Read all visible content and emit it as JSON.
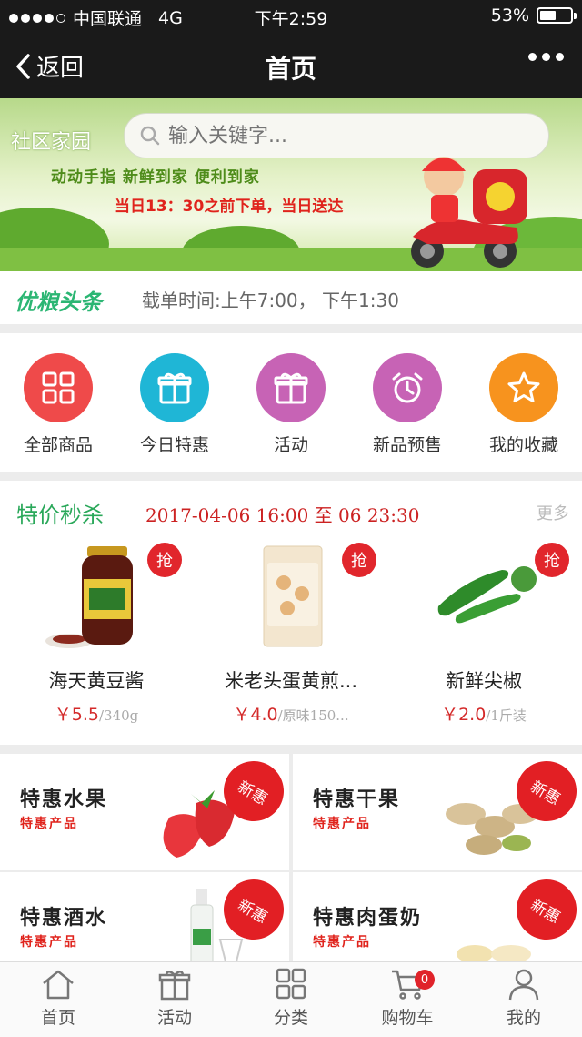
{
  "status": {
    "carrier": "中国联通",
    "network": "4G",
    "time": "下午2:59",
    "battery": "53%",
    "battery_level": 0.53
  },
  "nav": {
    "back_label": "返回",
    "title": "首页"
  },
  "banner": {
    "brand": "社区家园",
    "search_placeholder": "输入关键字...",
    "slogan": "动动手指  新鲜到家  便利到家",
    "slogan2": "当日13：30之前下单，当日送达"
  },
  "notice": {
    "tag": "优粮头条",
    "text": "截单时间:上午7:00，  下午1:30"
  },
  "categories": [
    {
      "label": "全部商品",
      "icon": "grid-icon",
      "color": "#ef4a4a"
    },
    {
      "label": "今日特惠",
      "icon": "gift-icon",
      "color": "#1fb6d6"
    },
    {
      "label": "活动",
      "icon": "gift-icon",
      "color": "#c763b5"
    },
    {
      "label": "新品预售",
      "icon": "alarm-clock-icon",
      "color": "#c763b5"
    },
    {
      "label": "我的收藏",
      "icon": "star-icon",
      "color": "#f7931e"
    }
  ],
  "flash_sale": {
    "title": "特价秒杀",
    "time": "2017-04-06 16:00 至 06 23:30",
    "more": "更多",
    "grab_label": "抢",
    "products": [
      {
        "name": "海天黄豆酱",
        "price": "￥5.5",
        "unit": "/340g"
      },
      {
        "name": "米老头蛋黄煎...",
        "price": "￥4.0",
        "unit": "/原味150..."
      },
      {
        "name": "新鲜尖椒",
        "price": "￥2.0",
        "unit": "/1斤装"
      }
    ]
  },
  "specials": [
    {
      "title": "特惠水果",
      "sub": "特惠产品",
      "tag": "新惠"
    },
    {
      "title": "特惠干果",
      "sub": "特惠产品",
      "tag": "新惠"
    },
    {
      "title": "特惠酒水",
      "sub": "特惠产品",
      "tag": "新惠"
    },
    {
      "title": "特惠肉蛋奶",
      "sub": "特惠产品",
      "tag": "新惠"
    }
  ],
  "tabbar": [
    {
      "label": "首页",
      "icon": "home-icon"
    },
    {
      "label": "活动",
      "icon": "gift-icon"
    },
    {
      "label": "分类",
      "icon": "grid-icon"
    },
    {
      "label": "购物车",
      "icon": "cart-icon",
      "badge": "0"
    },
    {
      "label": "我的",
      "icon": "user-icon"
    }
  ]
}
